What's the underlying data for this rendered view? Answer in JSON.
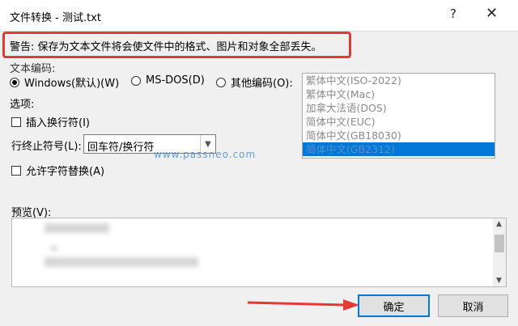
{
  "window": {
    "title": "文件转换 - 测试.txt",
    "help_glyph": "?",
    "close_glyph": "✕"
  },
  "warning": "警告: 保存为文本文件将会使文件中的格式、图片和对象全部丢失。",
  "encoding": {
    "section_label": "文本编码:",
    "options": [
      {
        "label": "Windows(默认)(W)",
        "selected": true
      },
      {
        "label": "MS-DOS(D)",
        "selected": false
      },
      {
        "label": "其他编码(O):",
        "selected": false
      }
    ],
    "list": [
      "繁体中文(ISO-2022)",
      "繁体中文(Mac)",
      "加拿大法语(DOS)",
      "简体中文(EUC)",
      "简体中文(GB18030)",
      "简体中文(GB2312)"
    ],
    "selected_index": 5
  },
  "options": {
    "section_label": "选项:",
    "insert_line_break": "插入换行符(I)",
    "line_end_label": "行终止符号(L):",
    "line_end_value": "回车符/换行符",
    "allow_substitution": "允许字符替换(A)"
  },
  "watermark": "www.passneo.com",
  "preview": {
    "label": "预览(V):"
  },
  "buttons": {
    "ok": "确定",
    "cancel": "取消"
  },
  "colors": {
    "accent": "#0078d7",
    "highlight": "#e53935"
  }
}
